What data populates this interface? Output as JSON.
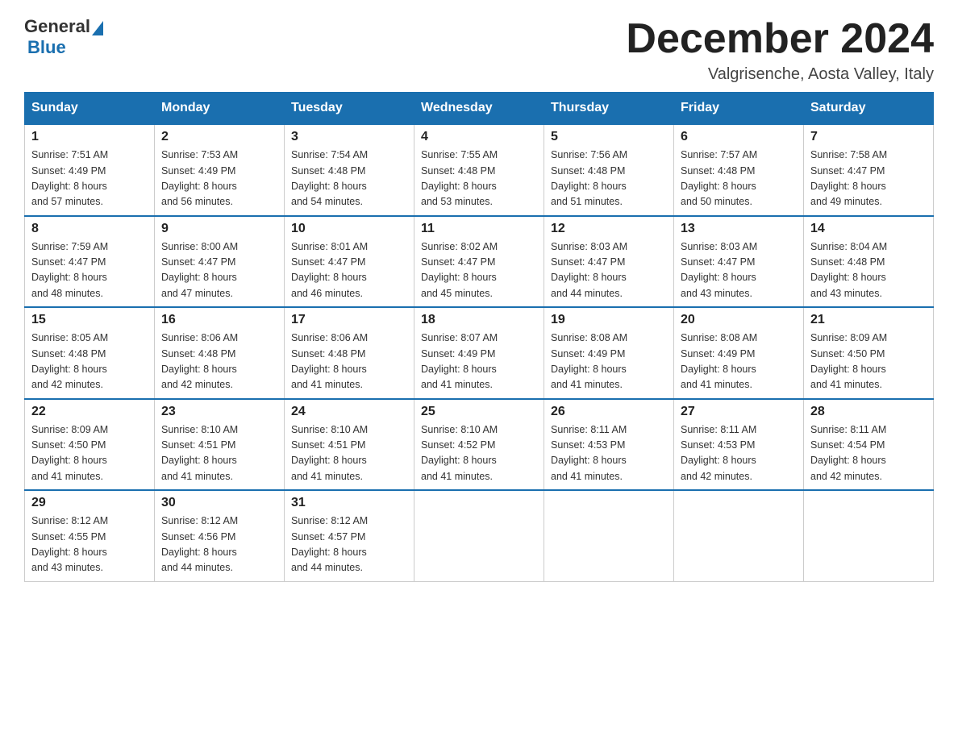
{
  "header": {
    "logo_general": "General",
    "logo_blue": "Blue",
    "title": "December 2024",
    "subtitle": "Valgrisenche, Aosta Valley, Italy"
  },
  "weekdays": [
    "Sunday",
    "Monday",
    "Tuesday",
    "Wednesday",
    "Thursday",
    "Friday",
    "Saturday"
  ],
  "weeks": [
    [
      {
        "day": "1",
        "sunrise": "7:51 AM",
        "sunset": "4:49 PM",
        "daylight": "8 hours and 57 minutes."
      },
      {
        "day": "2",
        "sunrise": "7:53 AM",
        "sunset": "4:49 PM",
        "daylight": "8 hours and 56 minutes."
      },
      {
        "day": "3",
        "sunrise": "7:54 AM",
        "sunset": "4:48 PM",
        "daylight": "8 hours and 54 minutes."
      },
      {
        "day": "4",
        "sunrise": "7:55 AM",
        "sunset": "4:48 PM",
        "daylight": "8 hours and 53 minutes."
      },
      {
        "day": "5",
        "sunrise": "7:56 AM",
        "sunset": "4:48 PM",
        "daylight": "8 hours and 51 minutes."
      },
      {
        "day": "6",
        "sunrise": "7:57 AM",
        "sunset": "4:48 PM",
        "daylight": "8 hours and 50 minutes."
      },
      {
        "day": "7",
        "sunrise": "7:58 AM",
        "sunset": "4:47 PM",
        "daylight": "8 hours and 49 minutes."
      }
    ],
    [
      {
        "day": "8",
        "sunrise": "7:59 AM",
        "sunset": "4:47 PM",
        "daylight": "8 hours and 48 minutes."
      },
      {
        "day": "9",
        "sunrise": "8:00 AM",
        "sunset": "4:47 PM",
        "daylight": "8 hours and 47 minutes."
      },
      {
        "day": "10",
        "sunrise": "8:01 AM",
        "sunset": "4:47 PM",
        "daylight": "8 hours and 46 minutes."
      },
      {
        "day": "11",
        "sunrise": "8:02 AM",
        "sunset": "4:47 PM",
        "daylight": "8 hours and 45 minutes."
      },
      {
        "day": "12",
        "sunrise": "8:03 AM",
        "sunset": "4:47 PM",
        "daylight": "8 hours and 44 minutes."
      },
      {
        "day": "13",
        "sunrise": "8:03 AM",
        "sunset": "4:47 PM",
        "daylight": "8 hours and 43 minutes."
      },
      {
        "day": "14",
        "sunrise": "8:04 AM",
        "sunset": "4:48 PM",
        "daylight": "8 hours and 43 minutes."
      }
    ],
    [
      {
        "day": "15",
        "sunrise": "8:05 AM",
        "sunset": "4:48 PM",
        "daylight": "8 hours and 42 minutes."
      },
      {
        "day": "16",
        "sunrise": "8:06 AM",
        "sunset": "4:48 PM",
        "daylight": "8 hours and 42 minutes."
      },
      {
        "day": "17",
        "sunrise": "8:06 AM",
        "sunset": "4:48 PM",
        "daylight": "8 hours and 41 minutes."
      },
      {
        "day": "18",
        "sunrise": "8:07 AM",
        "sunset": "4:49 PM",
        "daylight": "8 hours and 41 minutes."
      },
      {
        "day": "19",
        "sunrise": "8:08 AM",
        "sunset": "4:49 PM",
        "daylight": "8 hours and 41 minutes."
      },
      {
        "day": "20",
        "sunrise": "8:08 AM",
        "sunset": "4:49 PM",
        "daylight": "8 hours and 41 minutes."
      },
      {
        "day": "21",
        "sunrise": "8:09 AM",
        "sunset": "4:50 PM",
        "daylight": "8 hours and 41 minutes."
      }
    ],
    [
      {
        "day": "22",
        "sunrise": "8:09 AM",
        "sunset": "4:50 PM",
        "daylight": "8 hours and 41 minutes."
      },
      {
        "day": "23",
        "sunrise": "8:10 AM",
        "sunset": "4:51 PM",
        "daylight": "8 hours and 41 minutes."
      },
      {
        "day": "24",
        "sunrise": "8:10 AM",
        "sunset": "4:51 PM",
        "daylight": "8 hours and 41 minutes."
      },
      {
        "day": "25",
        "sunrise": "8:10 AM",
        "sunset": "4:52 PM",
        "daylight": "8 hours and 41 minutes."
      },
      {
        "day": "26",
        "sunrise": "8:11 AM",
        "sunset": "4:53 PM",
        "daylight": "8 hours and 41 minutes."
      },
      {
        "day": "27",
        "sunrise": "8:11 AM",
        "sunset": "4:53 PM",
        "daylight": "8 hours and 42 minutes."
      },
      {
        "day": "28",
        "sunrise": "8:11 AM",
        "sunset": "4:54 PM",
        "daylight": "8 hours and 42 minutes."
      }
    ],
    [
      {
        "day": "29",
        "sunrise": "8:12 AM",
        "sunset": "4:55 PM",
        "daylight": "8 hours and 43 minutes."
      },
      {
        "day": "30",
        "sunrise": "8:12 AM",
        "sunset": "4:56 PM",
        "daylight": "8 hours and 44 minutes."
      },
      {
        "day": "31",
        "sunrise": "8:12 AM",
        "sunset": "4:57 PM",
        "daylight": "8 hours and 44 minutes."
      },
      null,
      null,
      null,
      null
    ]
  ]
}
